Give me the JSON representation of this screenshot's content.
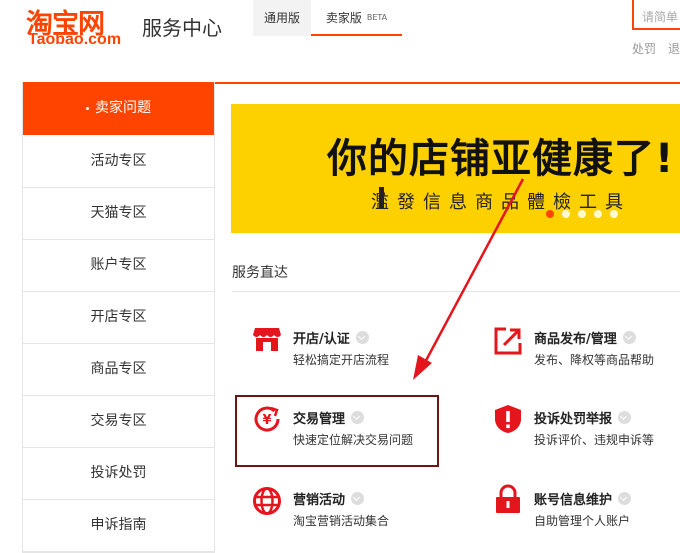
{
  "header": {
    "logo_cn": "淘宝网",
    "logo_en": "Taobao.com",
    "title": "服务中心",
    "tabs": [
      {
        "label": "通用版",
        "badge": ""
      },
      {
        "label": "卖家版",
        "badge": "BETA"
      }
    ],
    "search_placeholder": "请简单",
    "links": [
      "处罚",
      "退"
    ]
  },
  "sidebar": {
    "items": [
      {
        "label": "卖家问题",
        "active": true
      },
      {
        "label": "活动专区",
        "active": false
      },
      {
        "label": "天猫专区",
        "active": false
      },
      {
        "label": "账户专区",
        "active": false
      },
      {
        "label": "开店专区",
        "active": false
      },
      {
        "label": "商品专区",
        "active": false
      },
      {
        "label": "交易专区",
        "active": false
      },
      {
        "label": "投诉处罚",
        "active": false
      },
      {
        "label": "申诉指南",
        "active": false
      }
    ]
  },
  "banner": {
    "headline": "你的店铺亚健康了!",
    "subline": "濫發信息商品體檢工具",
    "slide_count": 5,
    "active_slide": 1
  },
  "services": {
    "heading": "服务直达",
    "items": [
      {
        "title": "开店/认证",
        "desc": "轻松搞定开店流程",
        "icon": "shop-icon"
      },
      {
        "title": "商品发布/管理",
        "desc": "发布、降权等商品帮助",
        "icon": "publish-arrow-icon"
      },
      {
        "title": "交易管理",
        "desc": "快速定位解决交易问题",
        "icon": "yuan-cycle-icon"
      },
      {
        "title": "投诉处罚举报",
        "desc": "投诉评价、违规申诉等",
        "icon": "alert-shield-icon"
      },
      {
        "title": "营销活动",
        "desc": "淘宝营销活动集合",
        "icon": "globe-icon"
      },
      {
        "title": "账号信息维护",
        "desc": "自助管理个人账户",
        "icon": "lock-icon"
      }
    ]
  },
  "colors": {
    "brand": "#ff4400",
    "banner_bg": "#fdd000",
    "highlight": "#6b1515",
    "icon_red": "#e4151d"
  }
}
